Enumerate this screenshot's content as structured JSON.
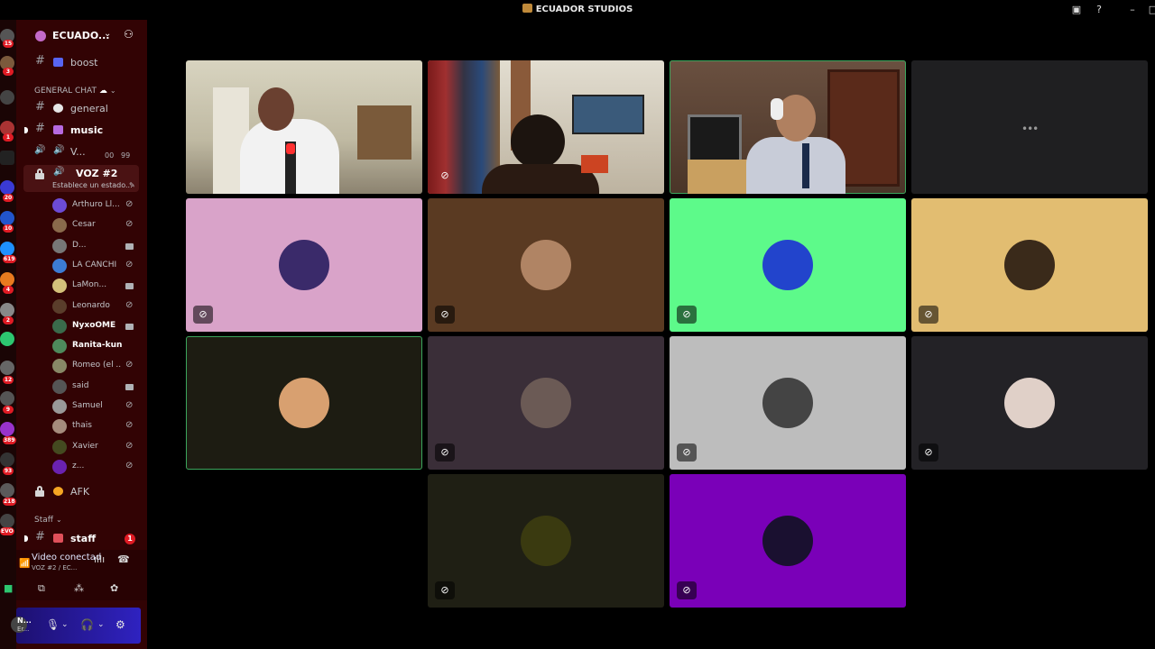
{
  "window": {
    "title": "ECUADOR STUDIOS"
  },
  "server": {
    "name": "ECUADO..."
  },
  "rail_badges": [
    "15",
    "3",
    "1",
    "20",
    "10",
    "619",
    "4",
    "2",
    "12",
    "9",
    "389",
    "93",
    "218",
    "EVO"
  ],
  "channels": {
    "boost": "boost",
    "category_general": "GENERAL CHAT",
    "general": "general",
    "music": "music",
    "voice1": "V...",
    "voice1_counts": [
      "00",
      "99"
    ],
    "voice2": "VOZ #2",
    "voice2_status": "Establece un estado...",
    "afk": "AFK",
    "category_staff": "Staff",
    "staff": "staff",
    "staff_badge": "1"
  },
  "members": [
    {
      "name": "Arthuro Ll...",
      "bold": false,
      "icon": "mic-muted-icon",
      "color": "#6c4bd6"
    },
    {
      "name": "Cesar",
      "bold": false,
      "icon": "mic-muted-icon",
      "color": "#8a6a4c"
    },
    {
      "name": "D...",
      "bold": false,
      "icon": "camera-icon",
      "color": "#777"
    },
    {
      "name": "LA CANCHI",
      "bold": false,
      "icon": "mic-muted-icon",
      "color": "#3c7bd4"
    },
    {
      "name": "LaMon...",
      "bold": false,
      "icon": "camera-icon",
      "color": "#d4c07a"
    },
    {
      "name": "Leonardo",
      "bold": false,
      "icon": "mic-muted-icon",
      "color": "#5a3d2b"
    },
    {
      "name": "NyxoOME",
      "bold": true,
      "icon": "camera-icon",
      "color": "#3a6b4b"
    },
    {
      "name": "Ranita-kun",
      "bold": true,
      "icon": "",
      "color": "#4e8a5c"
    },
    {
      "name": "Romeo (el ...",
      "bold": false,
      "icon": "mic-muted-icon",
      "color": "#886"
    },
    {
      "name": "said",
      "bold": false,
      "icon": "camera-icon",
      "color": "#555"
    },
    {
      "name": "Samuel",
      "bold": false,
      "icon": "mic-muted-icon",
      "color": "#999"
    },
    {
      "name": "thais",
      "bold": false,
      "icon": "mic-muted-icon",
      "color": "#a58c7d"
    },
    {
      "name": "Xavier",
      "bold": false,
      "icon": "mic-muted-icon",
      "color": "#444a20"
    },
    {
      "name": "z...",
      "bold": false,
      "icon": "mic-muted-icon",
      "color": "#6a22b0"
    }
  ],
  "voice_panel": {
    "title": "Video conectad",
    "subtitle": "VOZ #2 / EC..."
  },
  "user_panel": {
    "name": "N...",
    "status": "Er..."
  },
  "tiles": [
    {
      "kind": "video",
      "scene": "woman-white-shirt",
      "speaking": false
    },
    {
      "kind": "video",
      "scene": "room-clothes-tv",
      "speaking": false,
      "muted": true
    },
    {
      "kind": "video",
      "scene": "boy-headphones-cabinet",
      "speaking": true
    },
    {
      "kind": "loading",
      "bg": "#1f1f21"
    },
    {
      "kind": "avatar",
      "bg": "#d9a3c9",
      "avatar": "#3a2a6a",
      "muted": true
    },
    {
      "kind": "avatar",
      "bg": "#5a3a22",
      "avatar": "#b08464",
      "muted": true
    },
    {
      "kind": "avatar",
      "bg": "#5dfa8a",
      "avatar": "#2244cc",
      "muted": true
    },
    {
      "kind": "avatar",
      "bg": "#e2bd71",
      "avatar": "#3a2a1a",
      "muted": true
    },
    {
      "kind": "avatar",
      "bg": "#1d1c12",
      "avatar": "#d8a070",
      "muted": false,
      "speaking": true
    },
    {
      "kind": "avatar",
      "bg": "#3a2e38",
      "avatar": "#6b5a55",
      "muted": true
    },
    {
      "kind": "avatar",
      "bg": "#bdbdbd",
      "avatar": "#444",
      "muted": true
    },
    {
      "kind": "avatar",
      "bg": "#232226",
      "avatar": "#e0d0c8",
      "muted": true
    },
    {
      "kind": "avatar",
      "bg": "#1f1f14",
      "avatar": "#3a3a10",
      "muted": true
    },
    {
      "kind": "avatar",
      "bg": "#7a00b8",
      "avatar": "#1a1030",
      "muted": true
    }
  ]
}
